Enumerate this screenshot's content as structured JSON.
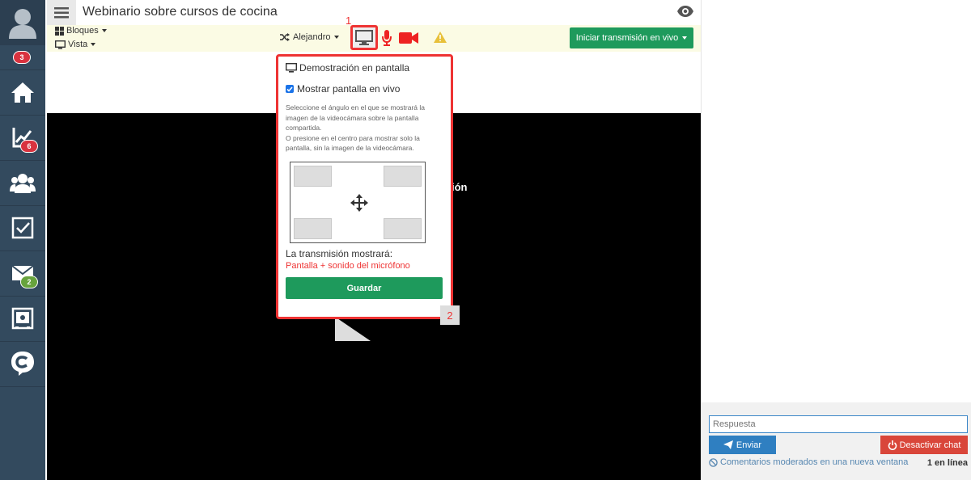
{
  "sidebar": {
    "badges": {
      "notifications": "3",
      "stats": "6",
      "messages": "2"
    },
    "items": [
      "user-avatar",
      "home-icon",
      "stats-icon",
      "users-icon",
      "tasks-icon",
      "mail-icon",
      "safe-icon",
      "chat-logo-icon"
    ]
  },
  "header": {
    "title": "Webinario sobre cursos de cocina"
  },
  "toolbar": {
    "blocks_label": "Bloques",
    "view_label": "Vista",
    "presenter_name": "Alejandro",
    "marker_1": "1",
    "live_button_label": "Iniciar transmisión en vivo"
  },
  "video": {
    "partial_text": "ión"
  },
  "popup": {
    "heading": "Demostración en pantalla",
    "checkbox_label": "Mostrar pantalla en vivo",
    "checkbox_checked": true,
    "description_1": "Seleccione el ángulo en el que se mostrará la imagen de la videocámara sobre la pantalla compartida.",
    "description_2": "O presione en el centro para mostrar solo la pantalla, sin la imagen de la videocámara.",
    "result_label": "La transmisión mostrará:",
    "result_value": "Pantalla + sonido del micrófono",
    "save_label": "Guardar",
    "marker_2": "2"
  },
  "chat": {
    "reply_placeholder": "Respuesta",
    "send_label": "Enviar",
    "disable_label": "Desactivar chat",
    "moderated_link": "Comentarios moderados en una nueva ventana",
    "online_count": "1 en línea"
  },
  "colors": {
    "sidebar": "#334a5e",
    "accent_green": "#1e9a5c",
    "highlight_red": "#ee3333",
    "send_blue": "#2f7fc1",
    "toolbar_bg": "#fbfbe4"
  }
}
